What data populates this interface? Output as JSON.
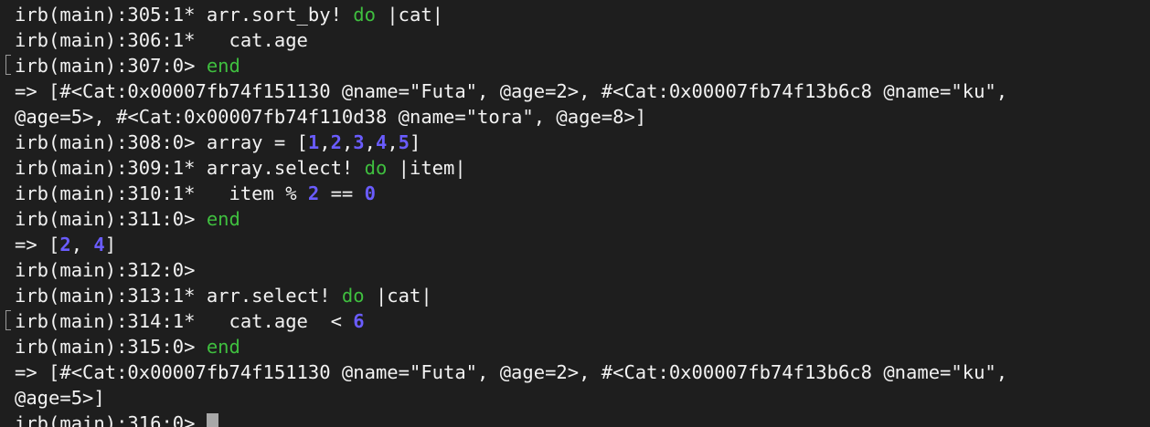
{
  "terminal": {
    "colors": {
      "background": "#1e1e1e",
      "text": "#f2f2f2",
      "keyword": "#3fbf3f",
      "number": "#6a5cff",
      "cursor": "#a8a8a8"
    },
    "lines": [
      [
        {
          "t": "irb(main):305:1* arr.sort_by! "
        },
        {
          "t": "do",
          "c": "kw"
        },
        {
          "t": " |cat|"
        }
      ],
      [
        {
          "t": "irb(main):306:1*   cat.age"
        }
      ],
      [
        {
          "t": "irb(main):307:0> "
        },
        {
          "t": "end",
          "c": "kw"
        }
      ],
      [
        {
          "t": "=> [#<Cat:0x00007fb74f151130 @name=\"Futa\", @age=2>, #<Cat:0x00007fb74f13b6c8 @name=\"ku\","
        }
      ],
      [
        {
          "t": "@age=5>, #<Cat:0x00007fb74f110d38 @name=\"tora\", @age=8>]"
        }
      ],
      [
        {
          "t": "irb(main):308:0> array = ["
        },
        {
          "t": "1",
          "c": "num"
        },
        {
          "t": ","
        },
        {
          "t": "2",
          "c": "num"
        },
        {
          "t": ","
        },
        {
          "t": "3",
          "c": "num"
        },
        {
          "t": ","
        },
        {
          "t": "4",
          "c": "num"
        },
        {
          "t": ","
        },
        {
          "t": "5",
          "c": "num"
        },
        {
          "t": "]"
        }
      ],
      [
        {
          "t": "irb(main):309:1* array.select! "
        },
        {
          "t": "do",
          "c": "kw"
        },
        {
          "t": " |item|"
        }
      ],
      [
        {
          "t": "irb(main):310:1*   item % "
        },
        {
          "t": "2",
          "c": "num"
        },
        {
          "t": " == "
        },
        {
          "t": "0",
          "c": "num"
        }
      ],
      [
        {
          "t": "irb(main):311:0> "
        },
        {
          "t": "end",
          "c": "kw"
        }
      ],
      [
        {
          "t": "=> ["
        },
        {
          "t": "2",
          "c": "num"
        },
        {
          "t": ", "
        },
        {
          "t": "4",
          "c": "num"
        },
        {
          "t": "]"
        }
      ],
      [
        {
          "t": "irb(main):312:0>"
        }
      ],
      [
        {
          "t": "irb(main):313:1* arr.select! "
        },
        {
          "t": "do",
          "c": "kw"
        },
        {
          "t": " |cat|"
        }
      ],
      [
        {
          "t": "irb(main):314:1*   cat.age  < "
        },
        {
          "t": "6",
          "c": "num"
        }
      ],
      [
        {
          "t": "irb(main):315:0> "
        },
        {
          "t": "end",
          "c": "kw"
        }
      ],
      [
        {
          "t": "=> [#<Cat:0x00007fb74f151130 @name=\"Futa\", @age=2>, #<Cat:0x00007fb74f13b6c8 @name=\"ku\","
        }
      ],
      [
        {
          "t": "@age=5>]"
        }
      ],
      [
        {
          "t": "irb(main):316:0> "
        }
      ]
    ],
    "cursor": "block-cursor"
  }
}
